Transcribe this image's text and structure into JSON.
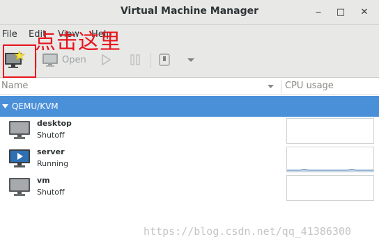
{
  "window": {
    "title": "Virtual Machine Manager",
    "minimize_glyph": "‒",
    "maximize_glyph": "□",
    "close_glyph": "✕"
  },
  "menu": {
    "items": [
      {
        "label": "File"
      },
      {
        "label": "Edit"
      },
      {
        "label": "View"
      },
      {
        "label": "Help"
      }
    ]
  },
  "toolbar": {
    "new_vm_icon": "new-vm-icon",
    "open_label": "Open",
    "run_icon": "play-icon",
    "pause_icon": "pause-icon",
    "shutdown_icon": "power-icon",
    "dropdown_icon": "chevron-down-icon"
  },
  "annotation": {
    "text": "点击这里",
    "color": "#e8141c"
  },
  "columns": {
    "name": "Name",
    "cpu": "CPU usage"
  },
  "group": {
    "label": "QEMU/KVM",
    "color": "#4a90d9"
  },
  "vms": [
    {
      "name": "desktop",
      "status": "Shutoff",
      "icon": "monitor-off-icon",
      "cpu_points": []
    },
    {
      "name": "server",
      "status": "Running",
      "icon": "monitor-running-icon",
      "cpu_points": [
        0.06,
        0.06,
        0.06,
        0.06,
        0.1,
        0.06,
        0.06,
        0.06,
        0.06,
        0.06,
        0.06,
        0.06,
        0.06,
        0.06,
        0.06,
        0.1,
        0.06,
        0.06,
        0.06,
        0.06,
        0.06
      ]
    },
    {
      "name": "vm",
      "status": "Shutoff",
      "icon": "monitor-off-icon",
      "cpu_points": []
    }
  ],
  "watermark": "https://blog.csdn.net/qq_41386300"
}
